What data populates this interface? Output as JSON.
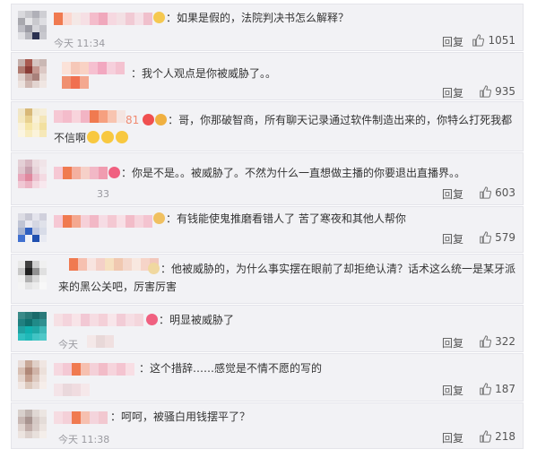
{
  "comments": [
    {
      "text": "：如果是假的，法院判决书怎么解释？",
      "time": "今天 11:34",
      "reply": "回复",
      "likes": "1051"
    },
    {
      "text": "：我个人观点是你被威胁了。。",
      "time": "",
      "reply": "回复",
      "likes": "935"
    },
    {
      "text": "：哥，你那破智商，所有聊天记录通过软件制造出来的，你特么打死我都不信啊",
      "time": "",
      "reply": "",
      "likes": ""
    },
    {
      "text": "：你是不是。。被威胁了。不然为什么一直想做主播的你要退出直播界。。",
      "time": "33",
      "reply": "回复",
      "likes": "603"
    },
    {
      "text": "：有钱能使鬼推磨看错人了 苦了寒夜和其他人帮你",
      "time": "",
      "reply": "回复",
      "likes": "579"
    },
    {
      "text": "：他被威胁的，为什么事实摆在眼前了却拒绝认清？话术这么统一是某牙派来的黑公关吧，厉害厉害",
      "time": "",
      "reply": "",
      "likes": ""
    },
    {
      "text": "：明显被威胁了",
      "time": "今天",
      "reply": "回复",
      "likes": "322"
    },
    {
      "text": "：这个措辞……感觉是不情不愿的写的",
      "time": "",
      "reply": "回复",
      "likes": "187"
    },
    {
      "text": "：呵呵，被骚白用钱摆平了？",
      "time": "今天 11:38",
      "reply": "回复",
      "likes": "218"
    }
  ],
  "name_fragments": [
    "81"
  ],
  "colors": {
    "card_bg": "#f2f2f5",
    "text": "#333333",
    "meta": "#9a9aa0",
    "accent_pink": "#f08aa0"
  },
  "icons": [
    "thumbs-up-icon",
    "emoji-icon",
    "badge-icon"
  ]
}
